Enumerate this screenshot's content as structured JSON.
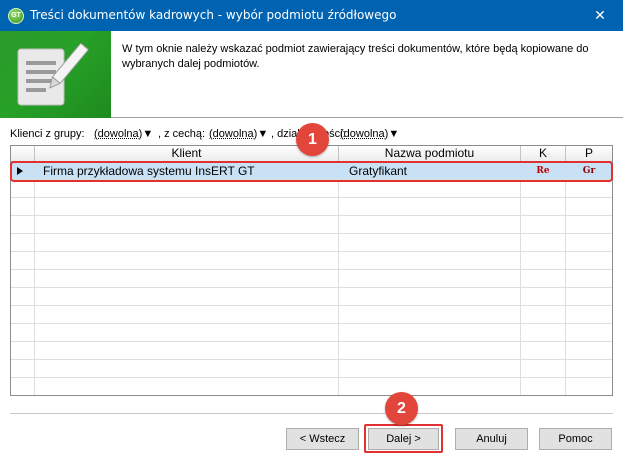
{
  "window": {
    "title": "Treści dokumentów kadrowych - wybór podmiotu źródłowego",
    "app_icon_text": "GT",
    "close_symbol": "✕"
  },
  "header": {
    "description": "W tym oknie należy wskazać podmiot zawierający treści dokumentów, które będą kopiowane do wybranych dalej podmiotów.",
    "banner_icon": "document-edit-icon"
  },
  "filters": {
    "group_label": "Klienci z grupy:",
    "group_value": "(dowolna)",
    "feature_label": ", z cechą:",
    "feature_value": "(dowolna)",
    "branch_label": ", dział",
    "branch_label_tail": "ości:",
    "branch_value": "(dowolna)",
    "arrow": "▼"
  },
  "grid": {
    "columns": [
      "Klient",
      "Nazwa podmiotu",
      "K",
      "P"
    ],
    "rows": [
      {
        "client": "Firma przykładowa systemu InsERT GT",
        "entity": "Gratyfikant",
        "k": "Re",
        "p": "Gr"
      }
    ]
  },
  "annotations": {
    "badge_1": "1",
    "badge_2": "2"
  },
  "buttons": {
    "back": "< Wstecz",
    "next": "Dalej >",
    "cancel": "Anuluj",
    "help": "Pomoc"
  },
  "colors": {
    "titlebar": "#0063b1",
    "banner": "#27a127",
    "highlight": "#e03030",
    "selected_row": "#c9e1f5"
  }
}
